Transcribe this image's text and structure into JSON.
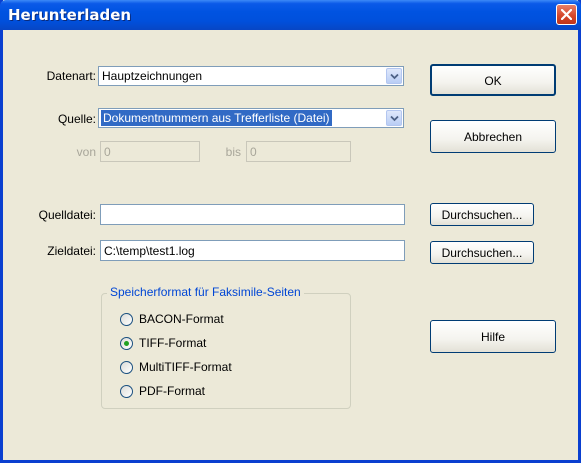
{
  "window": {
    "title": "Herunterladen"
  },
  "form": {
    "datenart": {
      "label": "Datenart:",
      "value": "Hauptzeichnungen"
    },
    "quelle": {
      "label": "Quelle:",
      "value": "Dokumentnummern aus Trefferliste (Datei)"
    },
    "von": {
      "label": "von",
      "value": "0"
    },
    "bis": {
      "label": "bis",
      "value": "0"
    },
    "quelldatei": {
      "label": "Quelldatei:",
      "value": ""
    },
    "zieldatei": {
      "label": "Zieldatei:",
      "value": "C:\\temp\\test1.log"
    }
  },
  "buttons": {
    "ok": "OK",
    "abbrechen": "Abbrechen",
    "durchsuchen1": "Durchsuchen...",
    "durchsuchen2": "Durchsuchen...",
    "hilfe": "Hilfe"
  },
  "format_group": {
    "title": "Speicherformat für Faksimile-Seiten",
    "options": [
      {
        "label": "BACON-Format",
        "selected": false
      },
      {
        "label": "TIFF-Format",
        "selected": true
      },
      {
        "label": "MultiTIFF-Format",
        "selected": false
      },
      {
        "label": "PDF-Format",
        "selected": false
      }
    ]
  },
  "colors": {
    "title_bar": "#0053e1",
    "accent": "#316ac5",
    "group_title": "#0046d5",
    "dialog_bg": "#ece9d8"
  }
}
